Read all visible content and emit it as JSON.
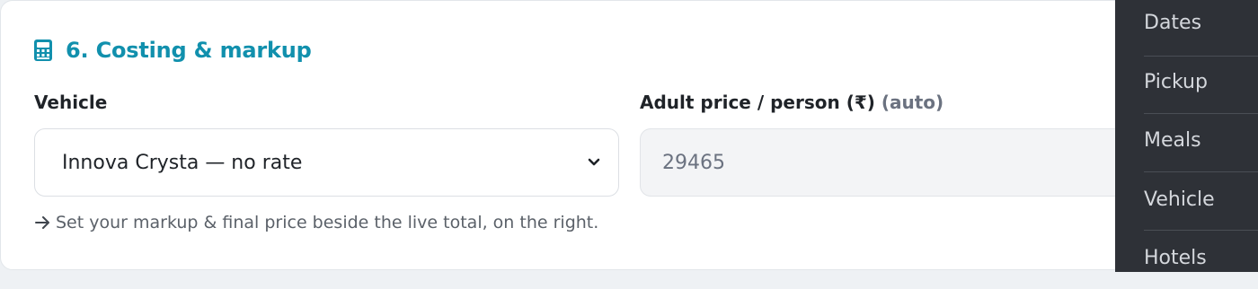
{
  "section": {
    "icon": "calculator-icon",
    "title": "6. Costing & markup"
  },
  "vehicle": {
    "label": "Vehicle",
    "selected": "Innova Crysta — no rate"
  },
  "adult_price": {
    "label": "Adult price / person (₹)",
    "suffix": "(auto)",
    "value": "29465"
  },
  "hint": {
    "icon": "arrow-right-icon",
    "text": "Set your markup & final price beside the live total, on the right."
  },
  "sidebar": {
    "items": [
      {
        "label": "Dates"
      },
      {
        "label": "Pickup"
      },
      {
        "label": "Meals"
      },
      {
        "label": "Vehicle"
      },
      {
        "label": "Hotels"
      }
    ]
  },
  "colors": {
    "accent": "#1190ad",
    "sidebar_bg": "#2e3137"
  }
}
